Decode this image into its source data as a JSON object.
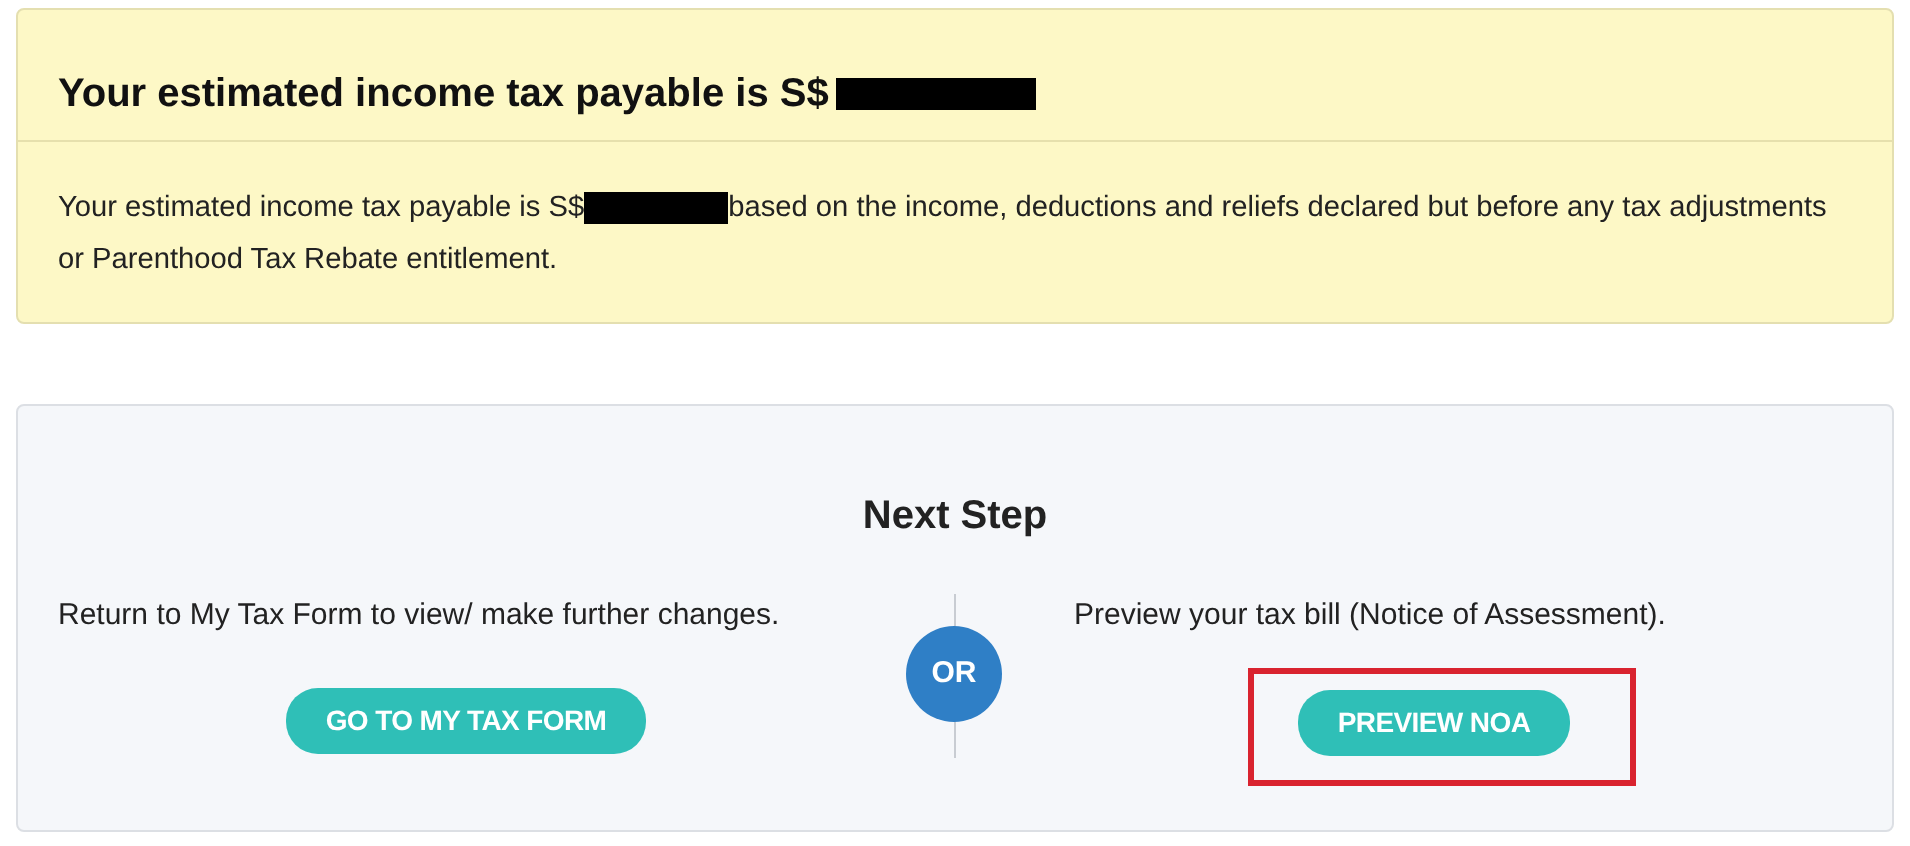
{
  "estimate_card": {
    "heading": "Your estimated income tax payable is S$",
    "heading_redacted": true,
    "text_before": "Your estimated income tax payable is S$",
    "text_redacted": true,
    "text_after": "based on the income, deductions and reliefs declared but before any tax adjustments or Parenthood Tax Rebate entitlement."
  },
  "next_step": {
    "title": "Next Step",
    "separator": "OR",
    "options": [
      {
        "text": "Return to My Tax Form to view/ make further changes.",
        "button": "GO TO MY TAX FORM",
        "highlighted": false
      },
      {
        "text": "Preview your tax bill (Notice of Assessment).",
        "button": "PREVIEW NOA",
        "highlighted": true
      }
    ]
  }
}
